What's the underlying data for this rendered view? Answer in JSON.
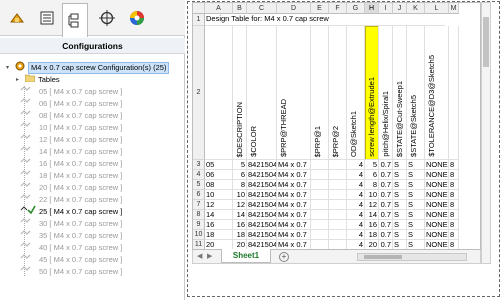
{
  "panel": {
    "title": "Configurations",
    "tabs": [
      "feature-manager-icon",
      "property-manager-icon",
      "configuration-manager-icon",
      "dim-xpert-icon",
      "display-manager-icon"
    ],
    "root_label": "M4 x 0.7 cap screw Configuration(s)  (25)",
    "tables_label": "Tables",
    "configs": [
      {
        "label": "05 [ M4 x 0.7 cap screw ]",
        "active": false
      },
      {
        "label": "06 [ M4 x 0.7 cap screw ]",
        "active": false
      },
      {
        "label": "08 [ M4 x 0.7 cap screw ]",
        "active": false
      },
      {
        "label": "10 [ M4 x 0.7 cap screw ]",
        "active": false
      },
      {
        "label": "12 [ M4 x 0.7 cap screw ]",
        "active": false
      },
      {
        "label": "14 [ M4 x 0.7 cap screw ]",
        "active": false
      },
      {
        "label": "16 [ M4 x 0.7 cap screw ]",
        "active": false
      },
      {
        "label": "18 [ M4 x 0.7 cap screw ]",
        "active": false
      },
      {
        "label": "20 [ M4 x 0.7 cap screw ]",
        "active": false
      },
      {
        "label": "22 [ M4 x 0.7 cap screw ]",
        "active": false
      },
      {
        "label": "25 [ M4 x 0.7 cap screw ]",
        "active": true
      },
      {
        "label": "30 [ M4 x 0.7 cap screw ]",
        "active": false
      },
      {
        "label": "35 [ M4 x 0.7 cap screw ]",
        "active": false
      },
      {
        "label": "40 [ M4 x 0.7 cap screw ]",
        "active": false
      },
      {
        "label": "45 [ M4 x 0.7 cap screw ]",
        "active": false
      },
      {
        "label": "50 [ M4 x 0.7 cap screw ]",
        "active": false
      }
    ]
  },
  "sheet": {
    "columns": [
      "A",
      "B",
      "C",
      "D",
      "E",
      "F",
      "G",
      "H",
      "I",
      "J",
      "K",
      "L",
      "M"
    ],
    "selected_column": "H",
    "title_row": "Design Table for: M4 x 0.7 cap screw",
    "headers": [
      "",
      "$DESCRIPTION",
      "$COLOR",
      "$PRP@THREAD",
      "$PRP@1",
      "$PRP@2",
      "OD@Sketch1",
      "screw length@Extrude1",
      "pitch@Helix/Spiral1",
      "$STATE@Cut-Sweep1",
      "$STATE@Sketch5",
      "$TOLERANCE@D3@Sketch5",
      ""
    ],
    "rows": [
      {
        "n": "3",
        "cells": [
          "05",
          "5",
          "8421504",
          "M4 x 0.7",
          "",
          "",
          "4",
          "5",
          "0.7",
          "S",
          "S",
          "NONE",
          "8"
        ]
      },
      {
        "n": "4",
        "cells": [
          "06",
          "6",
          "8421504",
          "M4 x 0.7",
          "",
          "",
          "4",
          "6",
          "0.7",
          "S",
          "S",
          "NONE",
          "8"
        ]
      },
      {
        "n": "5",
        "cells": [
          "08",
          "8",
          "8421504",
          "M4 x 0.7",
          "",
          "",
          "4",
          "8",
          "0.7",
          "S",
          "S",
          "NONE",
          "8"
        ]
      },
      {
        "n": "6",
        "cells": [
          "10",
          "10",
          "8421504",
          "M4 x 0.7",
          "",
          "",
          "4",
          "10",
          "0.7",
          "S",
          "S",
          "NONE",
          "8"
        ]
      },
      {
        "n": "7",
        "cells": [
          "12",
          "12",
          "8421504",
          "M4 x 0.7",
          "",
          "",
          "4",
          "12",
          "0.7",
          "S",
          "S",
          "NONE",
          "8"
        ]
      },
      {
        "n": "8",
        "cells": [
          "14",
          "14",
          "8421504",
          "M4 x 0.7",
          "",
          "",
          "4",
          "14",
          "0.7",
          "S",
          "S",
          "NONE",
          "8"
        ]
      },
      {
        "n": "9",
        "cells": [
          "16",
          "16",
          "8421504",
          "M4 x 0.7",
          "",
          "",
          "4",
          "16",
          "0.7",
          "S",
          "S",
          "NONE",
          "8"
        ]
      },
      {
        "n": "10",
        "cells": [
          "18",
          "18",
          "8421504",
          "M4 x 0.7",
          "",
          "",
          "4",
          "18",
          "0.7",
          "S",
          "S",
          "NONE",
          "8"
        ]
      },
      {
        "n": "11",
        "cells": [
          "20",
          "20",
          "8421504",
          "M4 x 0.7",
          "",
          "",
          "4",
          "20",
          "0.7",
          "S",
          "S",
          "NONE",
          "8"
        ]
      }
    ],
    "tab_label": "Sheet1",
    "add_sheet": "+",
    "highlight_color": "#ffff00"
  }
}
